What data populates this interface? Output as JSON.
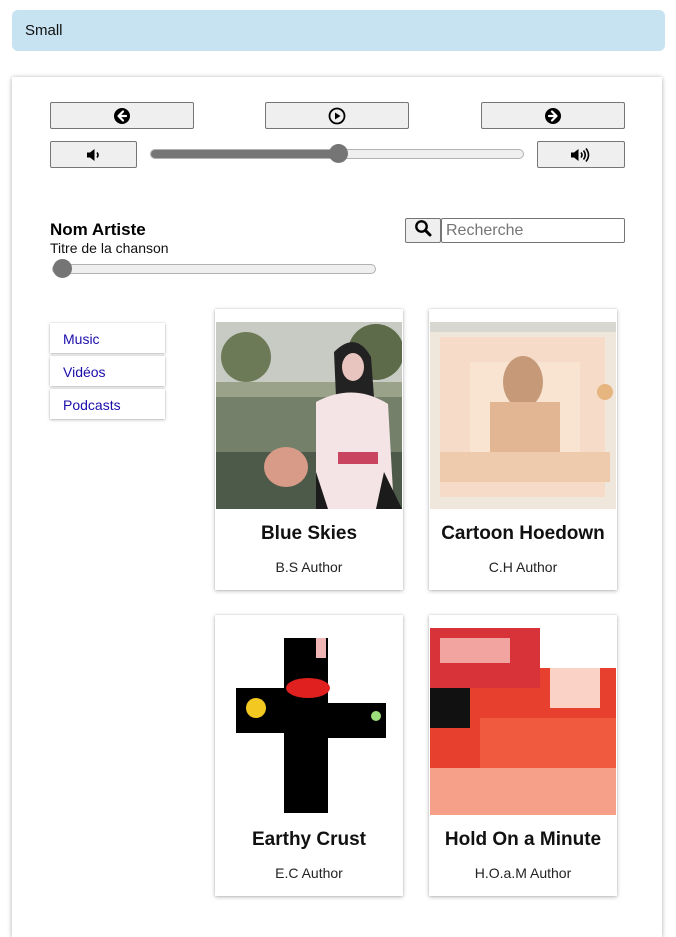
{
  "banner": {
    "label": "Small"
  },
  "player": {
    "prev_icon": "arrow-left-circle-icon",
    "play_icon": "play-circle-icon",
    "next_icon": "arrow-right-circle-icon",
    "volume_down_icon": "volume-down-icon",
    "volume_up_icon": "volume-up-icon",
    "volume_level": 0.5
  },
  "now_playing": {
    "artist": "Nom Artiste",
    "title": "Titre de la chanson",
    "progress": 0.0
  },
  "search": {
    "icon": "search-icon",
    "placeholder": "Recherche",
    "value": ""
  },
  "nav": {
    "items": [
      {
        "label": "Music"
      },
      {
        "label": "Vidéos"
      },
      {
        "label": "Podcasts"
      }
    ]
  },
  "albums": [
    {
      "title": "Blue Skies",
      "author": "B.S Author"
    },
    {
      "title": "Cartoon Hoedown",
      "author": "C.H Author"
    },
    {
      "title": "Earthy Crust",
      "author": "E.C Author"
    },
    {
      "title": "Hold On a Minute",
      "author": "H.O.a.M Author"
    }
  ],
  "colors": {
    "banner_bg": "#c7e3f1",
    "link": "#1a0dab",
    "slider": "#757575"
  }
}
